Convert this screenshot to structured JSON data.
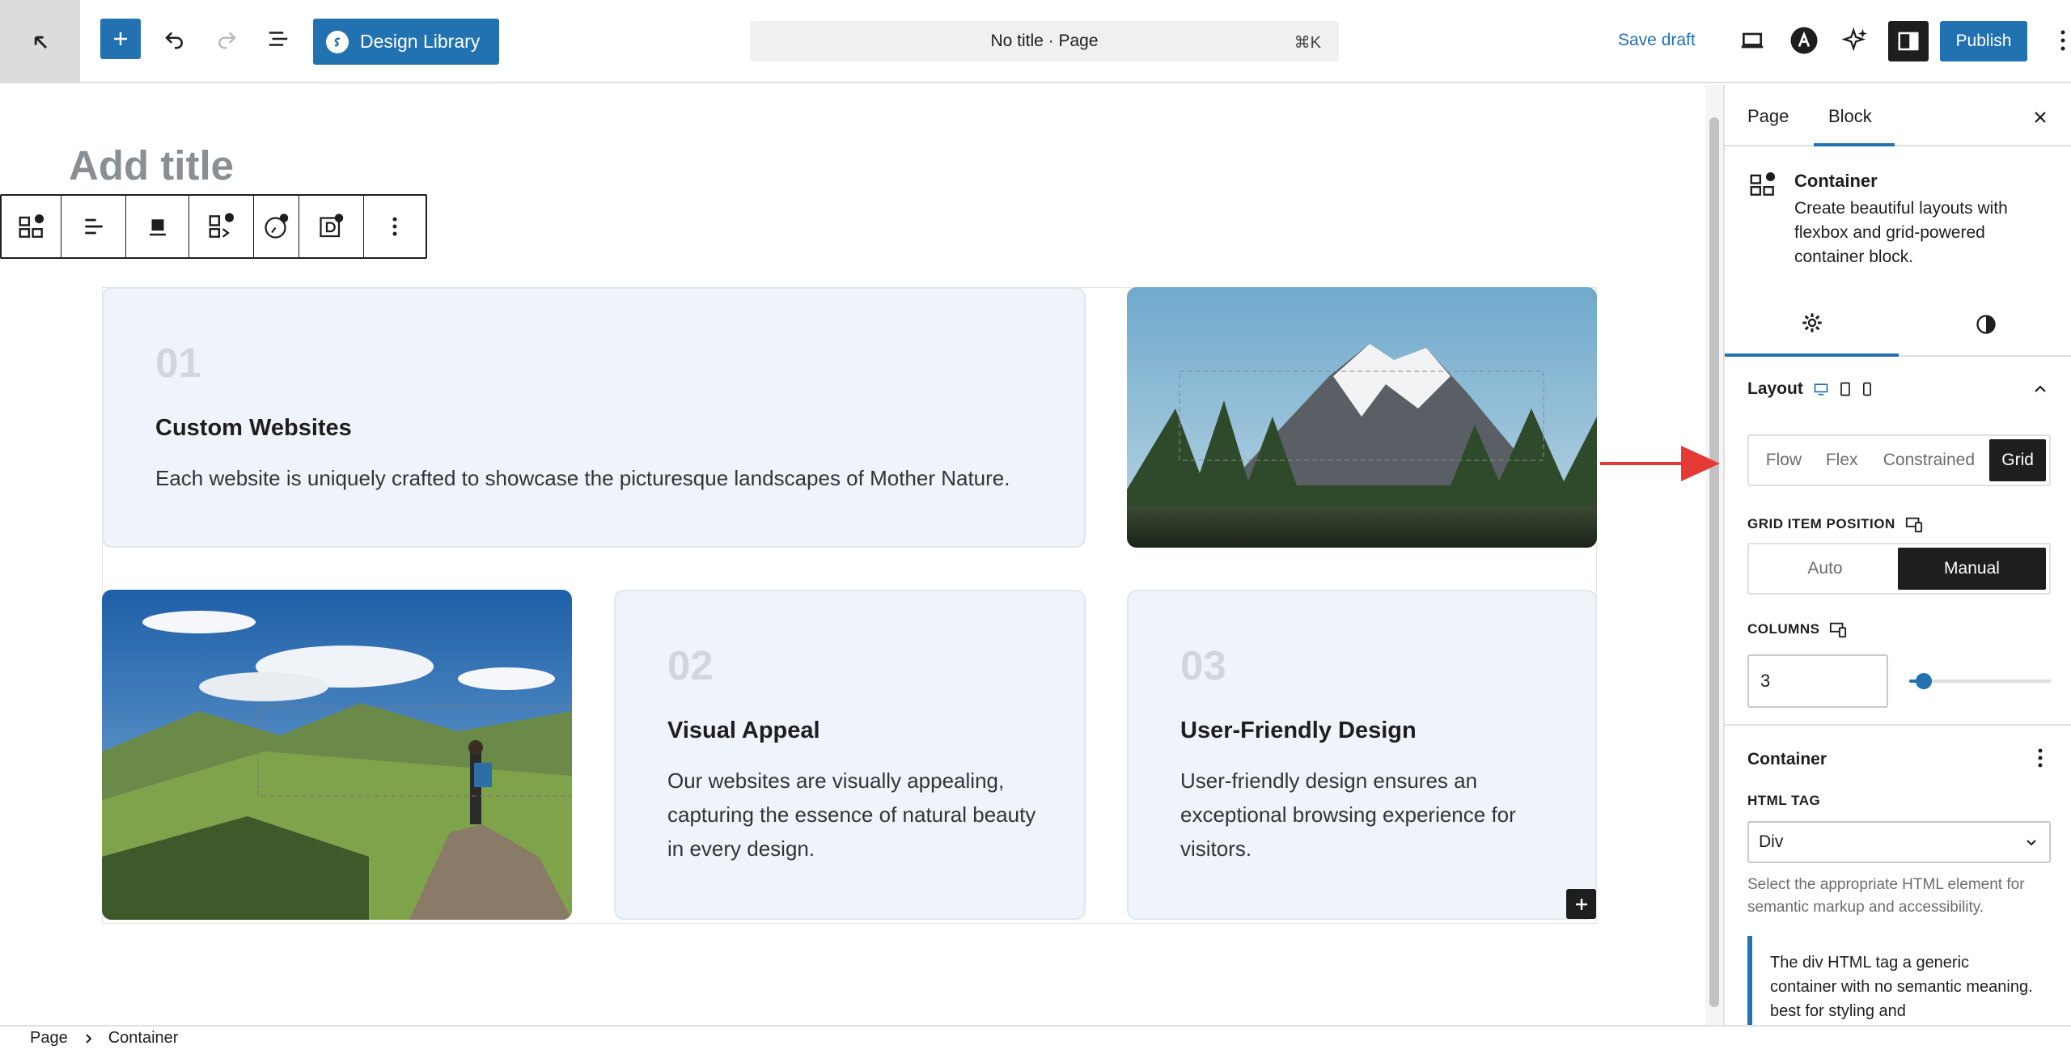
{
  "topbar": {
    "design_library_label": "Design Library",
    "command_title": "No title · Page",
    "command_shortcut": "⌘K",
    "save_draft_label": "Save draft",
    "publish_label": "Publish"
  },
  "editor": {
    "title_placeholder": "Add title",
    "cards": [
      {
        "number": "01",
        "title": "Custom Websites",
        "text": "Each website is uniquely crafted to showcase the picturesque landscapes of Mother Nature."
      },
      {
        "number": "02",
        "title": "Visual Appeal",
        "text": "Our websites are visually appealing, capturing the essence of natural beauty in every design."
      },
      {
        "number": "03",
        "title": "User-Friendly Design",
        "text": "User-friendly design ensures an exceptional browsing experience for visitors."
      }
    ]
  },
  "sidebar": {
    "tabs": [
      "Page",
      "Block"
    ],
    "active_tab": "Block",
    "block_name": "Container",
    "block_description": "Create beautiful layouts with flexbox and grid-powered container block.",
    "layout_label": "Layout",
    "layout_options": [
      "Flow",
      "Flex",
      "Constrained",
      "Grid"
    ],
    "layout_selected": "Grid",
    "grid_item_position_label": "GRID ITEM POSITION",
    "position_options": [
      "Auto",
      "Manual"
    ],
    "position_selected": "Manual",
    "columns_label": "COLUMNS",
    "columns_value": "3",
    "columns_slider_fraction": 0.1,
    "container_section_label": "Container",
    "html_tag_label": "HTML TAG",
    "html_tag_value": "Div",
    "html_tag_help": "Select the appropriate HTML element for semantic markup and accessibility.",
    "notice_text": "The div HTML tag a generic container with no semantic meaning. best for styling and"
  },
  "footer": {
    "breadcrumb": [
      "Page",
      "Container"
    ]
  },
  "colors": {
    "accent": "#2271b1",
    "card_bg": "#eff4fb",
    "annotation_arrow": "#e53935"
  }
}
